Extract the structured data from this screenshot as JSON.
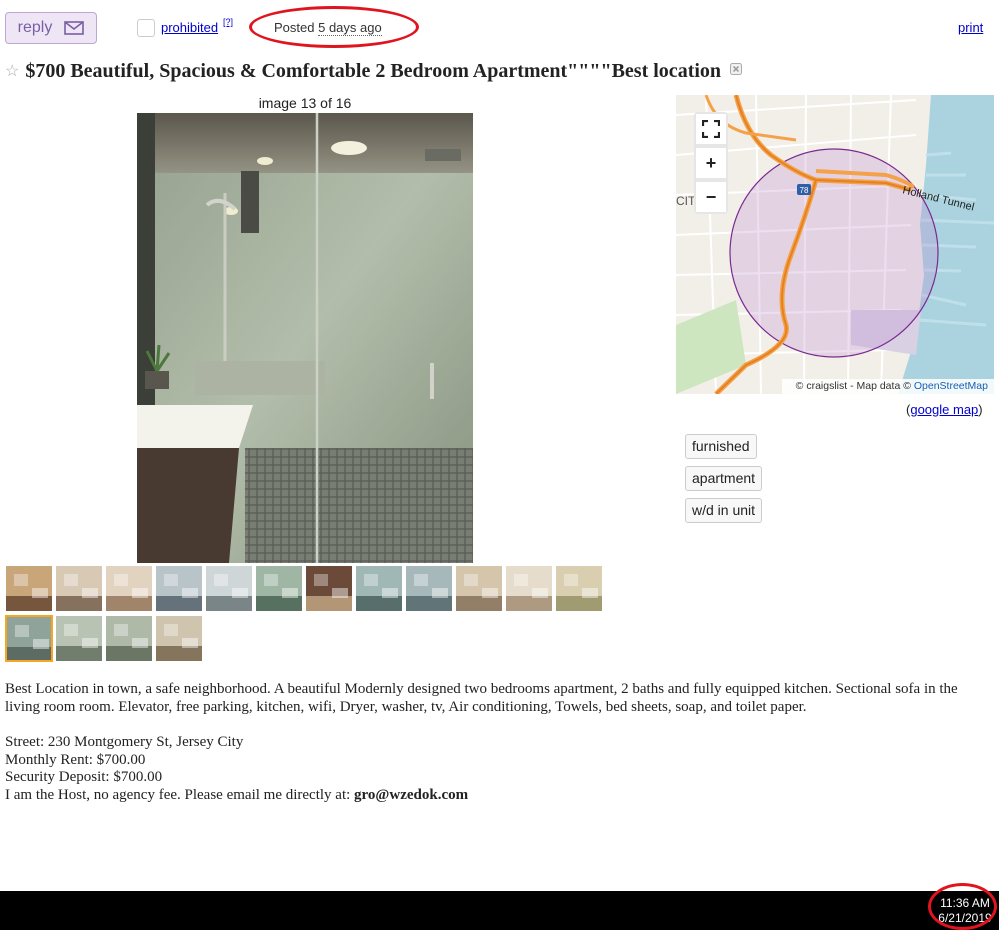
{
  "header": {
    "reply_label": "reply",
    "prohibited_label": "prohibited",
    "prohibited_help": "[?]",
    "posted_label": "Posted",
    "posted_ago": "5 days ago",
    "print_label": "print"
  },
  "post": {
    "title": "$700 Beautiful, Spacious & Comfortable 2 Bedroom Apartment\"\"\"\"Best location"
  },
  "gallery": {
    "counter": "image 13 of 16",
    "thumbnail_count": 16,
    "active_index": 13
  },
  "map": {
    "attribution_prefix": "© craigslist - Map data ©",
    "attribution_link": "OpenStreetMap",
    "road_label": "Holland Tunnel",
    "shield": "78",
    "partial_label": "CIT",
    "zoom_in": "+",
    "zoom_out": "−",
    "google_open": "(",
    "google_link": "google map",
    "google_close": ")"
  },
  "attributes": [
    "furnished",
    "apartment",
    "w/d in unit"
  ],
  "description": {
    "para1": "Best Location in town, a safe neighborhood. A beautiful Modernly designed two bedrooms apartment, 2 baths and fully equipped kitchen. Sectional sofa in the living room room. Elevator, free parking, kitchen, wifi, Dryer, washer, tv, Air conditioning, Towels, bed sheets, soap, and toilet paper.",
    "street": "Street: 230 Montgomery St, Jersey City",
    "rent": "Monthly Rent: $700.00",
    "deposit": "Security Deposit: $700.00",
    "contact_prefix": "I am the Host, no agency fee. Please email me directly at: ",
    "contact_email": "gro@wzedok.com"
  },
  "taskbar": {
    "time": "11:36 AM",
    "date": "6/21/2019"
  },
  "colors": {
    "link": "#0000cc",
    "reply_bg": "#eee6f5",
    "reply_fg": "#7b5ea6",
    "annotation": "#e0141e",
    "active_thumb": "#f5a623"
  }
}
